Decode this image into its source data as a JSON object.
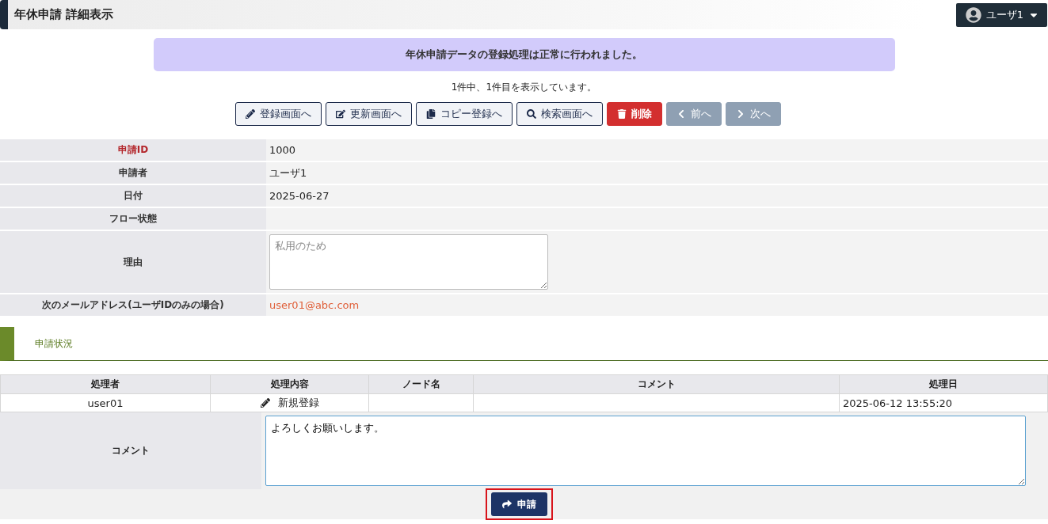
{
  "header": {
    "title": "年休申請 詳細表示",
    "user_menu": {
      "label": "ユーザ1"
    }
  },
  "alert": "年休申請データの登録処理は正常に行われました。",
  "record_count": "1件中、1件目を表示しています。",
  "actions": [
    {
      "label": "登録画面へ",
      "kind": "outline"
    },
    {
      "label": "更新画面へ",
      "kind": "outline"
    },
    {
      "label": "コピー登録へ",
      "kind": "outline"
    },
    {
      "label": "検索画面へ",
      "kind": "outline"
    },
    {
      "label": "削除",
      "kind": "danger"
    },
    {
      "label": "前へ",
      "kind": "nav"
    },
    {
      "label": "次へ",
      "kind": "nav"
    }
  ],
  "fields": [
    {
      "label": "申請ID",
      "required": true,
      "kind": "text",
      "value": "1000"
    },
    {
      "label": "申請者",
      "required": false,
      "kind": "text",
      "value": "ユーザ1"
    },
    {
      "label": "日付",
      "required": false,
      "kind": "text",
      "value": "2025-06-27"
    },
    {
      "label": "フロー状態",
      "required": false,
      "kind": "empty"
    },
    {
      "label": "理由",
      "required": false,
      "kind": "textarea",
      "placeholder": "私用のため"
    },
    {
      "label": "次のメールアドレス(ユーザIDのみの場合)",
      "required": false,
      "kind": "link",
      "value": "user01@abc.com"
    }
  ],
  "section": {
    "title": "申請状況"
  },
  "history": {
    "columns": [
      "処理者",
      "処理内容",
      "ノード名",
      "コメント",
      "処理日"
    ],
    "rows": [
      {
        "cells": [
          "user01",
          "新規登録",
          "",
          "",
          "2025-06-12 13:55:20"
        ]
      }
    ]
  },
  "comment": {
    "label": "コメント",
    "value": "よろしくお願いします。"
  },
  "submit": {
    "label": "申請",
    "highlighted": true
  }
}
